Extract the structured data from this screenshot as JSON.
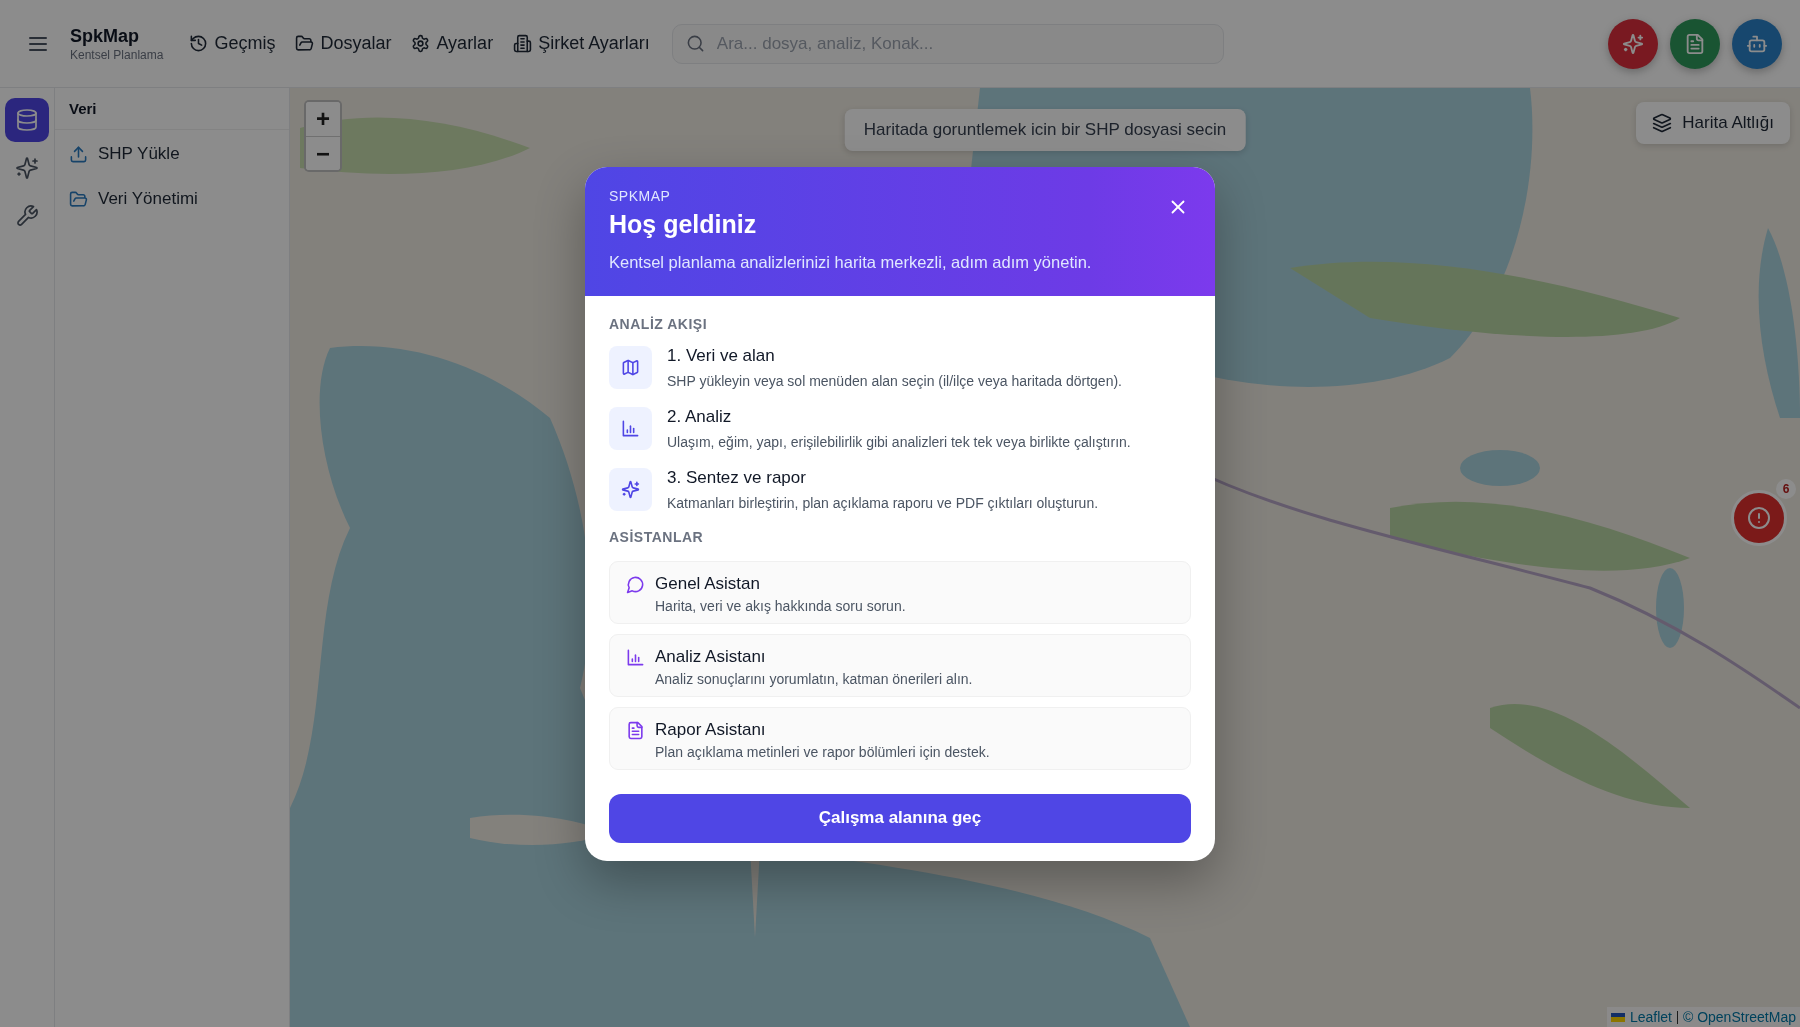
{
  "header": {
    "brand": "SpkMap",
    "subtitle": "Kentsel Planlama",
    "nav": [
      {
        "label": "Geçmiş"
      },
      {
        "label": "Dosyalar"
      },
      {
        "label": "Ayarlar"
      },
      {
        "label": "Şirket Ayarları"
      }
    ],
    "search": {
      "placeholder": "Ara... dosya, analiz, Konak..."
    }
  },
  "rail": [
    {
      "selected": true
    },
    {
      "selected": false
    },
    {
      "selected": false
    }
  ],
  "panel": {
    "title": "Veri",
    "items": [
      {
        "label": "SHP Yükle"
      },
      {
        "label": "Veri Yönetimi"
      }
    ]
  },
  "map": {
    "zoom_in": "+",
    "zoom_out": "−",
    "hint": "Haritada goruntlemek icin bir SHP dosyasi secin",
    "basemap_button": "Harita Altlığı",
    "alert_count": "6",
    "attribution": [
      "Leaflet",
      "© OpenStreetMap"
    ]
  },
  "modal": {
    "eyebrow": "SPKMAP",
    "title": "Hoş geldiniz",
    "subtitle": "Kentsel planlama analizlerinizi harita merkezli, adım adım yönetin.",
    "flow_heading": "ANALİZ AKIŞI",
    "steps": [
      {
        "title": "1. Veri ve alan",
        "description": "SHP yükleyin veya sol menüden alan seçin (il/ilçe veya haritada dörtgen)."
      },
      {
        "title": "2. Analiz",
        "description": "Ulaşım, eğim, yapı, erişilebilirlik gibi analizleri tek tek veya birlikte çalıştırın."
      },
      {
        "title": "3. Sentez ve rapor",
        "description": "Katmanları birleştirin, plan açıklama raporu ve PDF çıktıları oluşturun."
      }
    ],
    "assistants_heading": "ASİSTANLAR",
    "assistants": [
      {
        "title": "Genel Asistan",
        "description": "Harita, veri ve akış hakkında soru sorun."
      },
      {
        "title": "Analiz Asistanı",
        "description": "Analiz sonuçlarını yorumlatın, katman önerileri alın."
      },
      {
        "title": "Rapor Asistanı",
        "description": "Plan açıklama metinleri ve rapor bölümleri için destek."
      }
    ],
    "primary_button": "Çalışma alanına geç"
  }
}
